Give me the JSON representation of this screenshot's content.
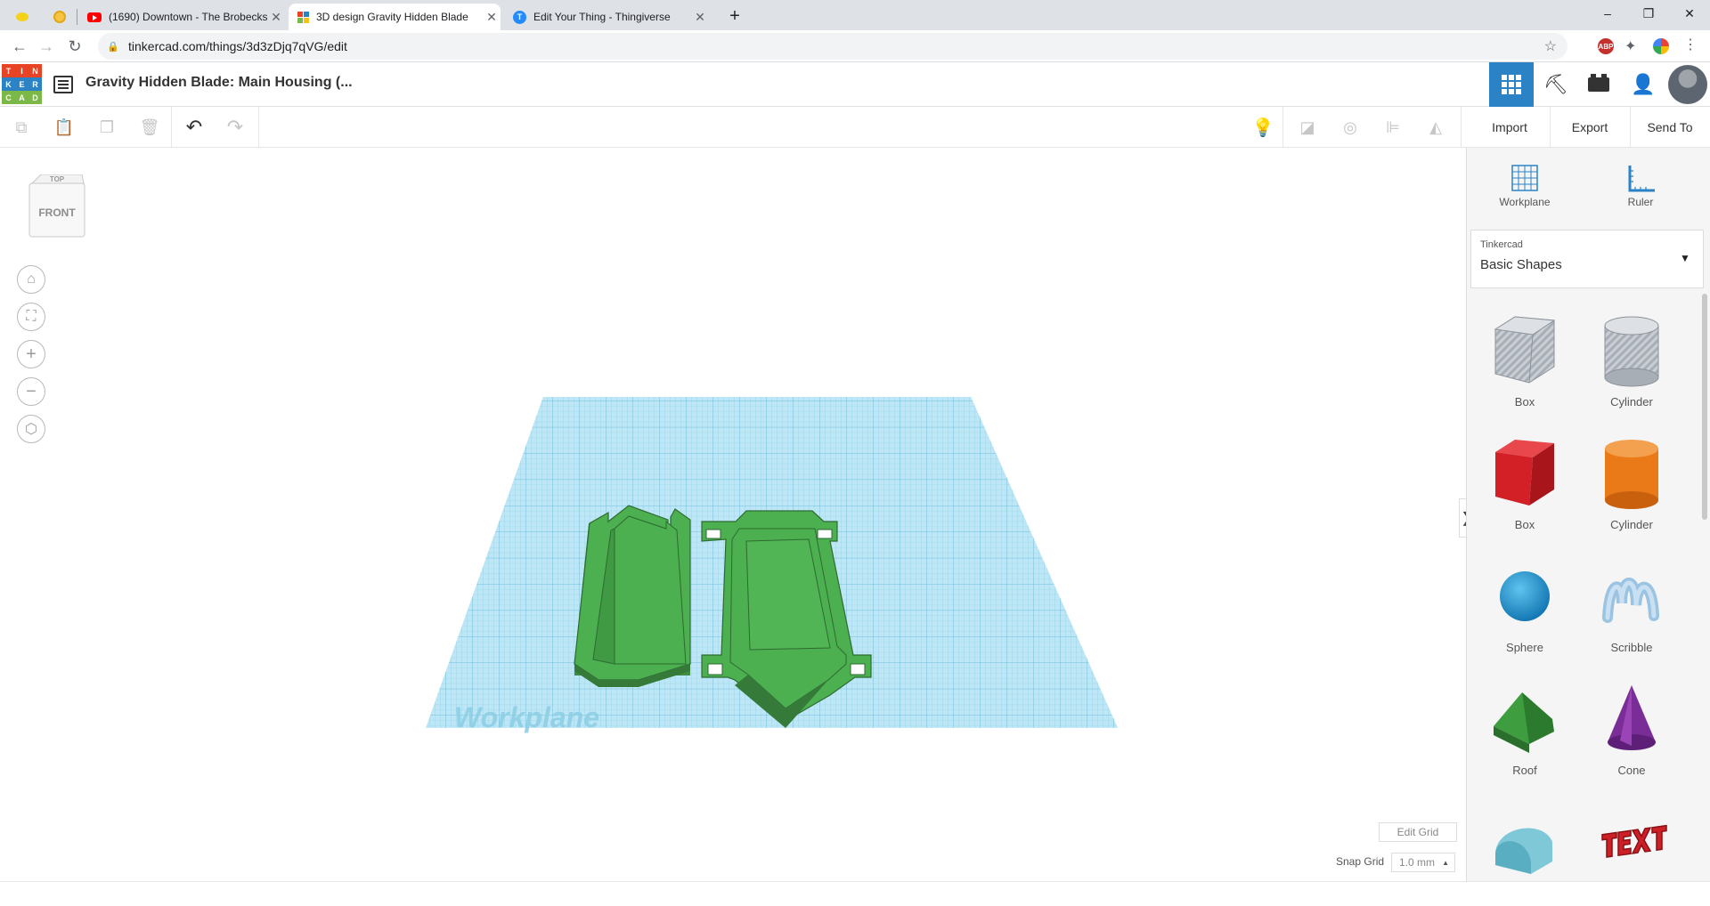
{
  "browser": {
    "tabs": [
      {
        "title": "",
        "icon": "pinned-app-icon"
      },
      {
        "title": "",
        "icon": "pinned-app-icon"
      },
      {
        "title": "(1690) Downtown - The Brobecks",
        "icon": "youtube-icon"
      },
      {
        "title": "3D design Gravity Hidden Blade",
        "icon": "tinkercad-icon"
      },
      {
        "title": "Edit Your Thing - Thingiverse",
        "icon": "thingiverse-icon"
      }
    ],
    "new_tab": "+",
    "url": "tinkercad.com/things/3d3zDjq7qVG/edit",
    "window_controls": {
      "minimize": "–",
      "restore": "❐",
      "close": "✕"
    }
  },
  "app": {
    "logo_letters": [
      "T",
      "I",
      "N",
      "K",
      "E",
      "R",
      "C",
      "A",
      "D"
    ],
    "logo_colors": [
      "#e94325",
      "#e94325",
      "#e94325",
      "#2b83c5",
      "#2b83c5",
      "#2b83c5",
      "#7cb848",
      "#7cb848",
      "#7cb848"
    ],
    "project_title": "Gravity Hidden Blade: Main Housing (...",
    "toolbar": {
      "import_label": "Import",
      "export_label": "Export",
      "send_to_label": "Send To"
    }
  },
  "viewport": {
    "view_cube": {
      "top": "TOP",
      "front": "FRONT"
    },
    "workplane_label": "Workplane",
    "edit_grid_label": "Edit Grid",
    "snap_grid_label": "Snap Grid",
    "snap_grid_value": "1.0 mm",
    "expand_panel": "❯"
  },
  "panel": {
    "workplane_label": "Workplane",
    "ruler_label": "Ruler",
    "library_provider": "Tinkercad",
    "library_name": "Basic Shapes",
    "shapes": [
      {
        "label": "Box",
        "icon": "striped-box-icon"
      },
      {
        "label": "Cylinder",
        "icon": "striped-cylinder-icon"
      },
      {
        "label": "Box",
        "icon": "red-box-icon"
      },
      {
        "label": "Cylinder",
        "icon": "orange-cylinder-icon"
      },
      {
        "label": "Sphere",
        "icon": "blue-sphere-icon"
      },
      {
        "label": "Scribble",
        "icon": "scribble-icon"
      },
      {
        "label": "Roof",
        "icon": "green-roof-icon"
      },
      {
        "label": "Cone",
        "icon": "purple-cone-icon"
      },
      {
        "label": "",
        "icon": "round-roof-icon"
      },
      {
        "label": "",
        "icon": "text-icon"
      }
    ]
  },
  "colors": {
    "accent": "#2b83c5",
    "model_green": "#45a84a",
    "workplane_blue": "#a6dcf0"
  }
}
